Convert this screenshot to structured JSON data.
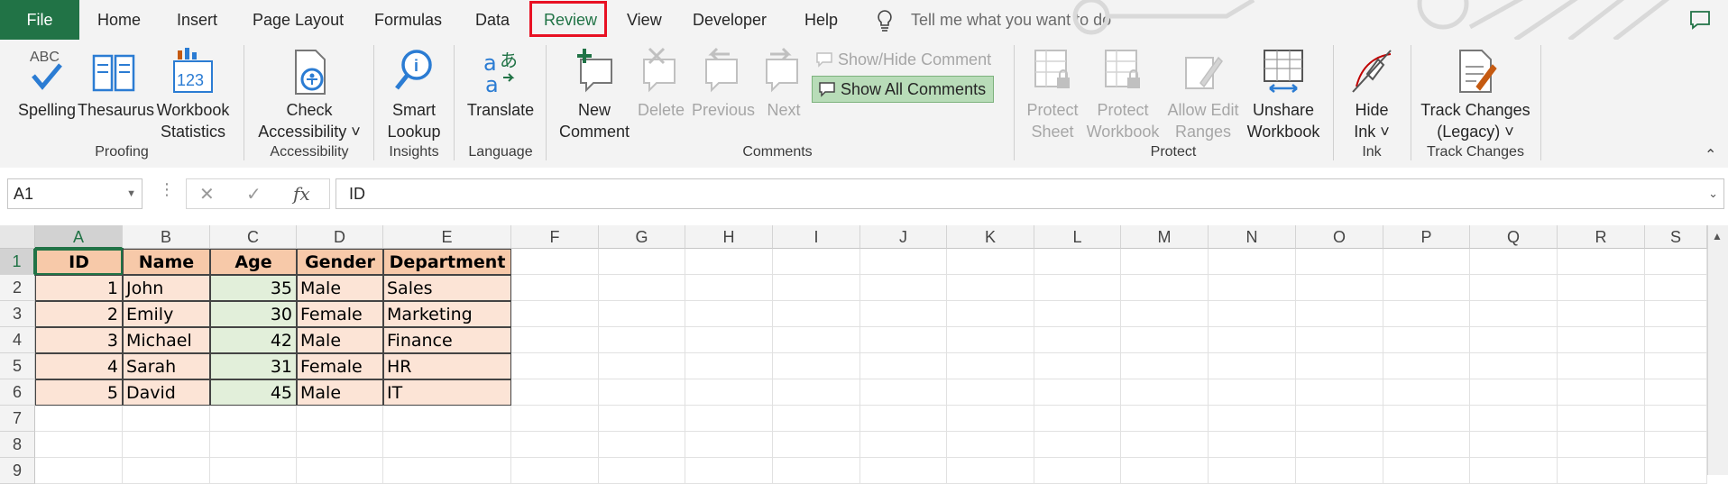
{
  "tabs": [
    "File",
    "Home",
    "Insert",
    "Page Layout",
    "Formulas",
    "Data",
    "Review",
    "View",
    "Developer",
    "Help"
  ],
  "active_tab": "Review",
  "tell_me": "Tell me what you want to do",
  "ribbon": {
    "proofing": {
      "label": "Proofing",
      "spelling": "Spelling",
      "thesaurus": "Thesaurus",
      "workbook_stats_1": "Workbook",
      "workbook_stats_2": "Statistics"
    },
    "accessibility": {
      "label": "Accessibility",
      "check_1": "Check",
      "check_2": "Accessibility ˅"
    },
    "insights": {
      "label": "Insights",
      "smart_1": "Smart",
      "smart_2": "Lookup"
    },
    "language": {
      "label": "Language",
      "translate": "Translate"
    },
    "comments": {
      "label": "Comments",
      "new_1": "New",
      "new_2": "Comment",
      "delete": "Delete",
      "previous": "Previous",
      "next": "Next",
      "show_hide": "Show/Hide Comment",
      "show_all": "Show All Comments"
    },
    "protect": {
      "label": "Protect",
      "protect_sheet_1": "Protect",
      "protect_sheet_2": "Sheet",
      "protect_wb_1": "Protect",
      "protect_wb_2": "Workbook",
      "allow_edit_1": "Allow Edit",
      "allow_edit_2": "Ranges",
      "unshare_1": "Unshare",
      "unshare_2": "Workbook"
    },
    "ink": {
      "label": "Ink",
      "hide_1": "Hide",
      "hide_2": "Ink ˅"
    },
    "track": {
      "label": "Track Changes",
      "track_1": "Track Changes",
      "track_2": "(Legacy) ˅"
    }
  },
  "formula_bar": {
    "name_box": "A1",
    "fx": "fx",
    "value": "ID"
  },
  "columns": [
    "A",
    "B",
    "C",
    "D",
    "E",
    "F",
    "G",
    "H",
    "I",
    "J",
    "K",
    "L",
    "M",
    "N",
    "O",
    "P",
    "Q",
    "R",
    "S"
  ],
  "rows": [
    "1",
    "2",
    "3",
    "4",
    "5",
    "6",
    "7",
    "8",
    "9"
  ],
  "table": {
    "headers": [
      "ID",
      "Name",
      "Age",
      "Gender",
      "Department"
    ],
    "rows": [
      [
        "1",
        "John",
        "35",
        "Male",
        "Sales"
      ],
      [
        "2",
        "Emily",
        "30",
        "Female",
        "Marketing"
      ],
      [
        "3",
        "Michael",
        "42",
        "Male",
        "Finance"
      ],
      [
        "4",
        "Sarah",
        "31",
        "Female",
        "HR"
      ],
      [
        "5",
        "David",
        "45",
        "Male",
        "IT"
      ]
    ]
  },
  "colors": {
    "excel_green": "#217346",
    "header_fill": "#f7c9a9",
    "peach_fill": "#fce4d6",
    "green_fill": "#e2efda",
    "highlight_box": "#e81123"
  }
}
